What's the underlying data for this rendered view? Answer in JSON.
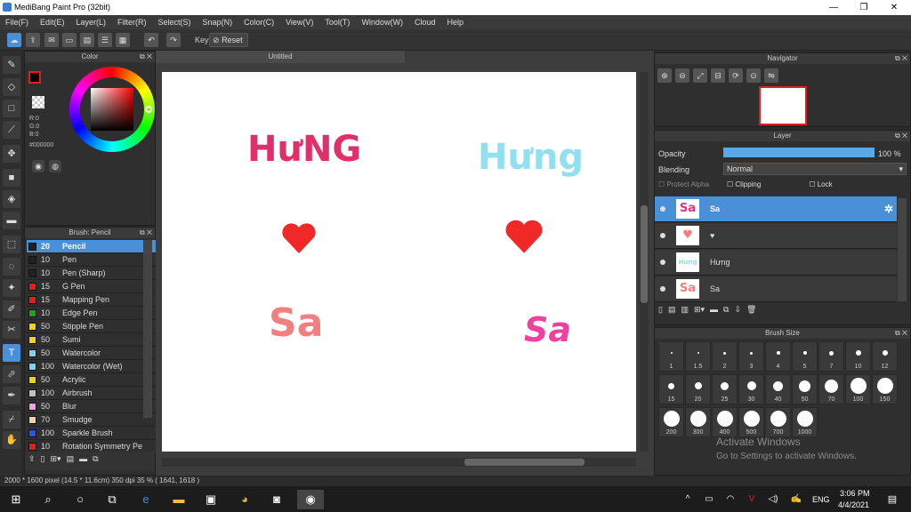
{
  "window": {
    "title": "MediBang Paint Pro (32bit)",
    "minimize": "—",
    "restore": "❐",
    "close": "✕"
  },
  "menu": [
    "File(F)",
    "Edit(E)",
    "Layer(L)",
    "Filter(R)",
    "Select(S)",
    "Snap(N)",
    "Color(C)",
    "View(V)",
    "Tool(T)",
    "Window(W)",
    "Cloud",
    "Help"
  ],
  "toolbar": {
    "key_label": "Key",
    "reset_label": "Reset"
  },
  "color_panel": {
    "title": "Color",
    "r": "R:0",
    "g": "G:0",
    "b": "B:0",
    "hex": "#000000"
  },
  "brush_panel": {
    "title": "Brush: Pencil",
    "items": [
      {
        "size": "20",
        "name": "Pencil",
        "color": "#222222"
      },
      {
        "size": "10",
        "name": "Pen",
        "color": "#222222"
      },
      {
        "size": "10",
        "name": "Pen (Sharp)",
        "color": "#222222"
      },
      {
        "size": "15",
        "name": "G Pen",
        "color": "#e02020"
      },
      {
        "size": "15",
        "name": "Mapping Pen",
        "color": "#e02020"
      },
      {
        "size": "10",
        "name": "Edge Pen",
        "color": "#20a020"
      },
      {
        "size": "50",
        "name": "Stipple Pen",
        "color": "#f0d020"
      },
      {
        "size": "50",
        "name": "Sumi",
        "color": "#f0d020"
      },
      {
        "size": "50",
        "name": "Watercolor",
        "color": "#80d0f0"
      },
      {
        "size": "100",
        "name": "Watercolor (Wet)",
        "color": "#80d0f0"
      },
      {
        "size": "50",
        "name": "Acrylic",
        "color": "#f0d020"
      },
      {
        "size": "100",
        "name": "Airbrush",
        "color": "#c0c0c0"
      },
      {
        "size": "50",
        "name": "Blur",
        "color": "#f0a0f0"
      },
      {
        "size": "70",
        "name": "Smudge",
        "color": "#f0d0b0"
      },
      {
        "size": "100",
        "name": "Sparkle Brush",
        "color": "#3050e0"
      },
      {
        "size": "10",
        "name": "Rotation Symmetry Pe",
        "color": "#e02020"
      }
    ]
  },
  "canvas": {
    "tab": "Untitled",
    "texts": [
      {
        "text": "HưNG",
        "color": "#e0306a"
      },
      {
        "text": "Hưng",
        "color": "#90e0f0"
      },
      {
        "text": "Sa",
        "color": "#f08080"
      },
      {
        "text": "Sa",
        "color": "#f040a0"
      }
    ],
    "heart_color": "#f02828"
  },
  "navigator": {
    "title": "Navigator"
  },
  "layer_panel": {
    "title": "Layer",
    "opacity_label": "Opacity",
    "opacity_value": "100 %",
    "opacity_fraction": 1.0,
    "blending_label": "Blending",
    "blending_value": "Normal",
    "protect_alpha": "Protect Alpha",
    "clipping": "Clipping",
    "lock": "Lock",
    "layers": [
      {
        "name": "Sa",
        "thumb": "Sa"
      },
      {
        "name": "♥",
        "thumb": "♥"
      },
      {
        "name": "Hưng",
        "thumb": "Hưng"
      },
      {
        "name": "Sa",
        "thumb": "Sa"
      }
    ]
  },
  "brush_size": {
    "title": "Brush Size",
    "sizes": [
      "1",
      "1.5",
      "2",
      "3",
      "4",
      "5",
      "7",
      "10",
      "12",
      "15",
      "20",
      "25",
      "30",
      "40",
      "50",
      "70",
      "100",
      "150",
      "200",
      "300",
      "400",
      "500",
      "700",
      "1000"
    ]
  },
  "watermark": {
    "line1": "Activate Windows",
    "line2": "Go to Settings to activate Windows."
  },
  "status": {
    "text": "2000 * 1600 pixel  (14.5 * 11.6cm)  350 dpi  35 %  ( 1641, 1618 )"
  },
  "taskbar": {
    "lang": "ENG",
    "time": "3:06 PM",
    "date": "4/4/2021"
  }
}
